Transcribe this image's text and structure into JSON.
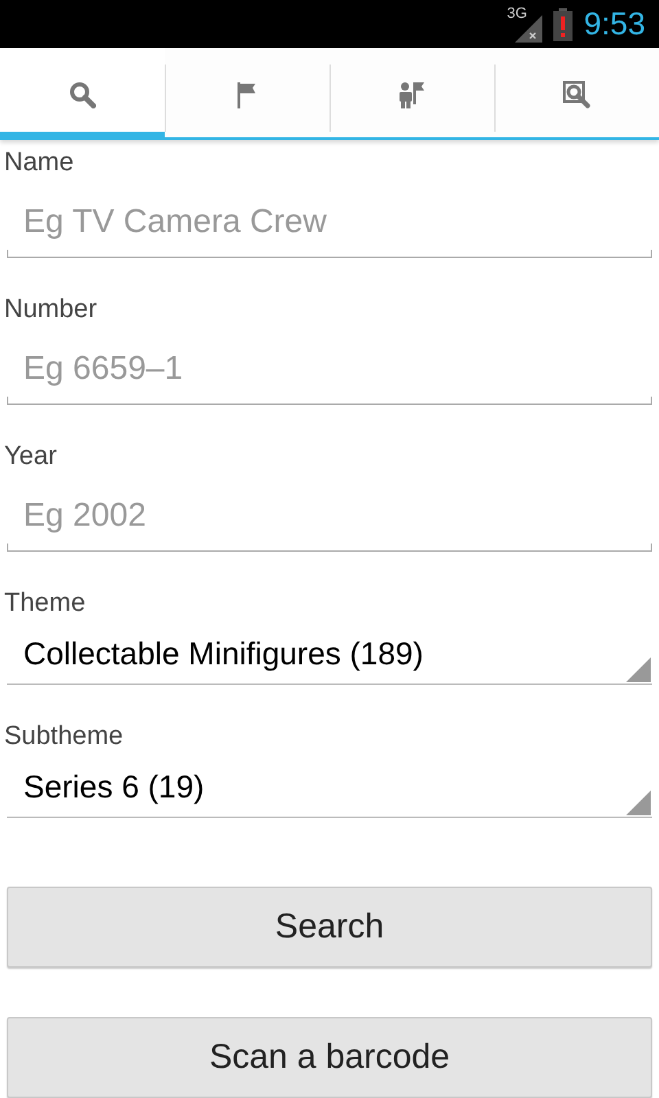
{
  "status_bar": {
    "network": "3G",
    "time": "9:53"
  },
  "tabs": [
    {
      "kind": "search",
      "selected": true
    },
    {
      "kind": "flag",
      "selected": false
    },
    {
      "kind": "figure",
      "selected": false
    },
    {
      "kind": "lookup",
      "selected": false
    }
  ],
  "fields": [
    {
      "kind": "text",
      "label": "Name",
      "placeholder": "Eg TV Camera Crew"
    },
    {
      "kind": "text",
      "label": "Number",
      "placeholder": "Eg 6659–1"
    },
    {
      "kind": "text",
      "label": "Year",
      "placeholder": "Eg 2002"
    },
    {
      "kind": "dropdown",
      "label": "Theme",
      "value": "Collectable Minifigures (189)"
    },
    {
      "kind": "dropdown",
      "label": "Subtheme",
      "value": "Series 6 (19)"
    }
  ],
  "buttons": [
    "Search",
    "Scan a barcode"
  ]
}
